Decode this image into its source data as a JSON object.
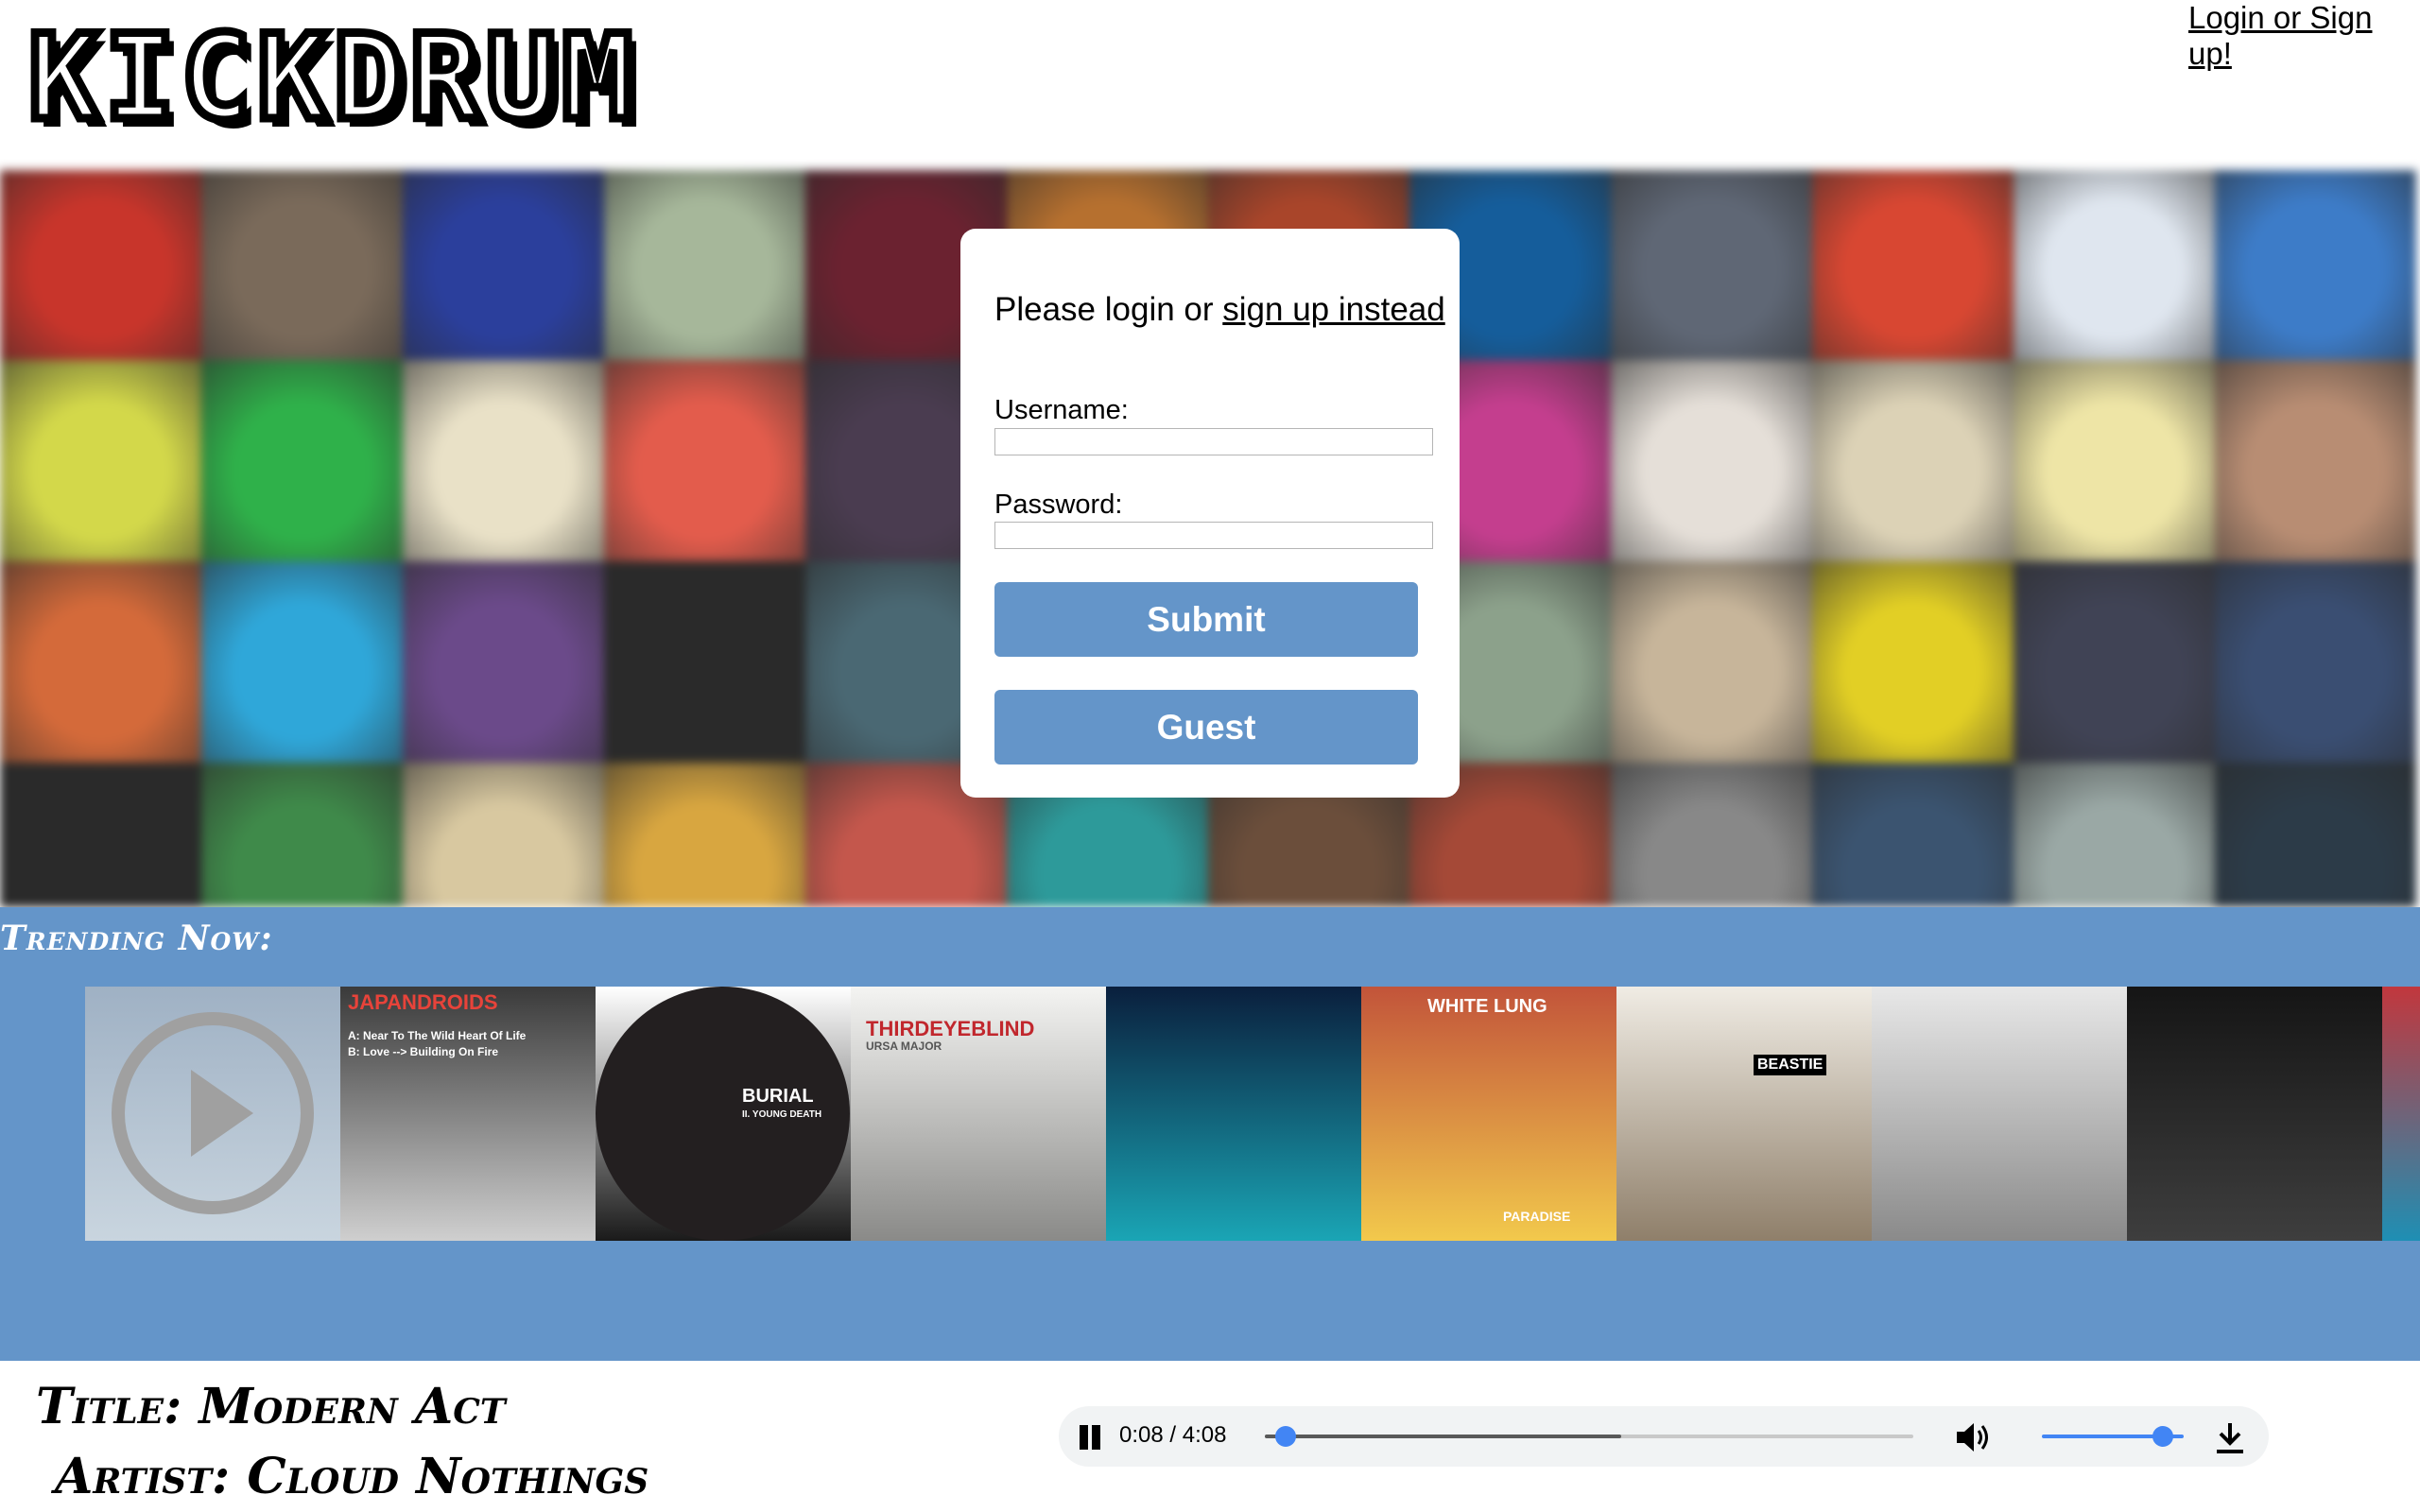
{
  "app": {
    "logo_text": "KICKDRUM",
    "login_link": "Login or Sign up!"
  },
  "login": {
    "prompt": "Please login or",
    "signup_link": "sign up instead",
    "username_label": "Username:",
    "password_label": "Password:",
    "submit_label": "Submit",
    "guest_label": "Guest"
  },
  "trending": {
    "title": "Trending Now:",
    "albums": [
      {
        "name": "album-cloud-nothings",
        "colors": [
          "#9fb1c4",
          "#c9d5df"
        ],
        "has_play": true
      },
      {
        "name": "album-japandroids",
        "colors": [
          "#3a3a3a",
          "#cfcfcf"
        ],
        "texts": [
          "JAPANDROIDS",
          "A: Near To The Wild Heart Of Life",
          "B: Love --> Building On Fire"
        ]
      },
      {
        "name": "album-burial",
        "colors": [
          "#ffffff",
          "#1a1a1a"
        ],
        "texts": [
          "BURIAL",
          "II. YOUNG DEATH"
        ]
      },
      {
        "name": "album-third-eye-blind",
        "colors": [
          "#f4f4f2",
          "#8a8a88"
        ],
        "texts": [
          "THIRDEYEBLIND",
          "URSA MAJOR"
        ]
      },
      {
        "name": "album-run-the-jewels",
        "colors": [
          "#0a1f3d",
          "#1aa5b5"
        ]
      },
      {
        "name": "album-white-lung",
        "colors": [
          "#c2543a",
          "#f2c94c"
        ],
        "texts": [
          "WHITE LUNG",
          "PARADISE"
        ]
      },
      {
        "name": "album-beastie-boys",
        "colors": [
          "#f0ece4",
          "#8f7f6a"
        ],
        "texts": [
          "BEASTIE"
        ]
      },
      {
        "name": "album-radiohead",
        "colors": [
          "#e8e8e8",
          "#8a8a8a"
        ]
      },
      {
        "name": "album-duo",
        "colors": [
          "#151515",
          "#3e3e3e"
        ]
      },
      {
        "name": "album-partial",
        "colors": [
          "#c2373d",
          "#1e8fb4"
        ]
      }
    ]
  },
  "player": {
    "title_text": "Title: Modern Act",
    "artist_text": "Artist: Cloud Nothings",
    "time_display": "0:08 / 4:08",
    "played_fraction": 0.032,
    "buffered_fraction": 0.55,
    "volume_level": 0.85
  },
  "colors": {
    "accent": "#6495c9",
    "player_accent": "#4285f4"
  },
  "mosaic_colors": [
    [
      "#c8352b",
      "#7a6a5a",
      "#2b3f9c",
      "#a6b79a",
      "#6b2230",
      "#b6702f",
      "#a9452a",
      "#155d9b",
      "#5f6775",
      "#d84732",
      "#dfe6ef",
      "#3d7cc8"
    ],
    [
      "#d3d84a",
      "#2fb14a",
      "#e9e1c7",
      "#e35c4c",
      "#4a3c50",
      "#1d2b57",
      "#9f9f9f",
      "#c43e8e",
      "#e5dfd8",
      "#dcd2b6",
      "#eee5a6",
      "#b88d73"
    ],
    [
      "#d46a3a",
      "#2fa7d9",
      "#6b4a8a",
      "#2a2a2a",
      "#4a6873",
      "#5a5e6b",
      "#6f7f3a",
      "#8ca18b",
      "#c7b59a",
      "#e2cf25",
      "#404355",
      "#3a4e72"
    ],
    [
      "#2a2a2a",
      "#3f8a4a",
      "#d8c8a0",
      "#d8a640",
      "#c4574c",
      "#2d9a9a",
      "#6b4e3b",
      "#a54937",
      "#888888",
      "#3b5470",
      "#9aa8a5",
      "#2c3b48"
    ]
  ]
}
